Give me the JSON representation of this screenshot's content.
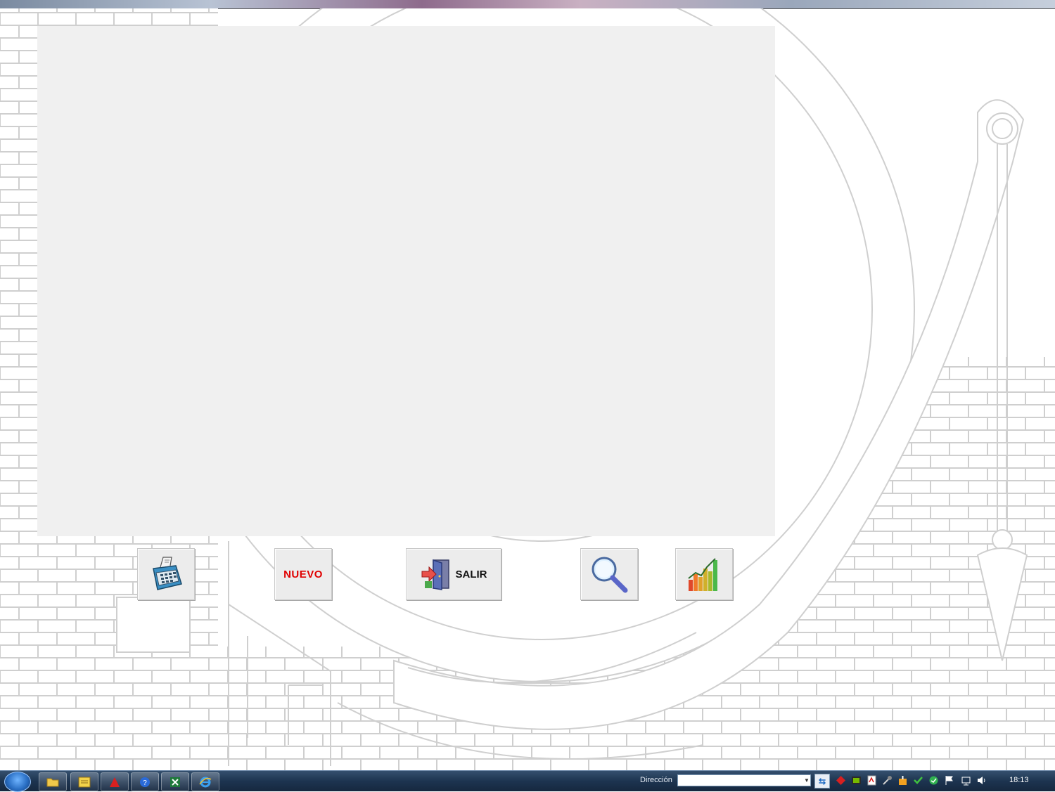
{
  "buttons": {
    "nuevo_label": "NUEVO",
    "salir_label": "SALIR"
  },
  "taskbar": {
    "address_label": "Dirección",
    "address_value": "",
    "clock": "18:13",
    "pinned": [
      "folder-icon",
      "cte-app-icon",
      "acrobat-icon",
      "help-icon",
      "excel-icon",
      "internet-explorer-icon"
    ]
  },
  "colors": {
    "panel": "#f0f0f0",
    "nuevo_text": "#e00000",
    "background_lines": "#d0d0d0"
  }
}
